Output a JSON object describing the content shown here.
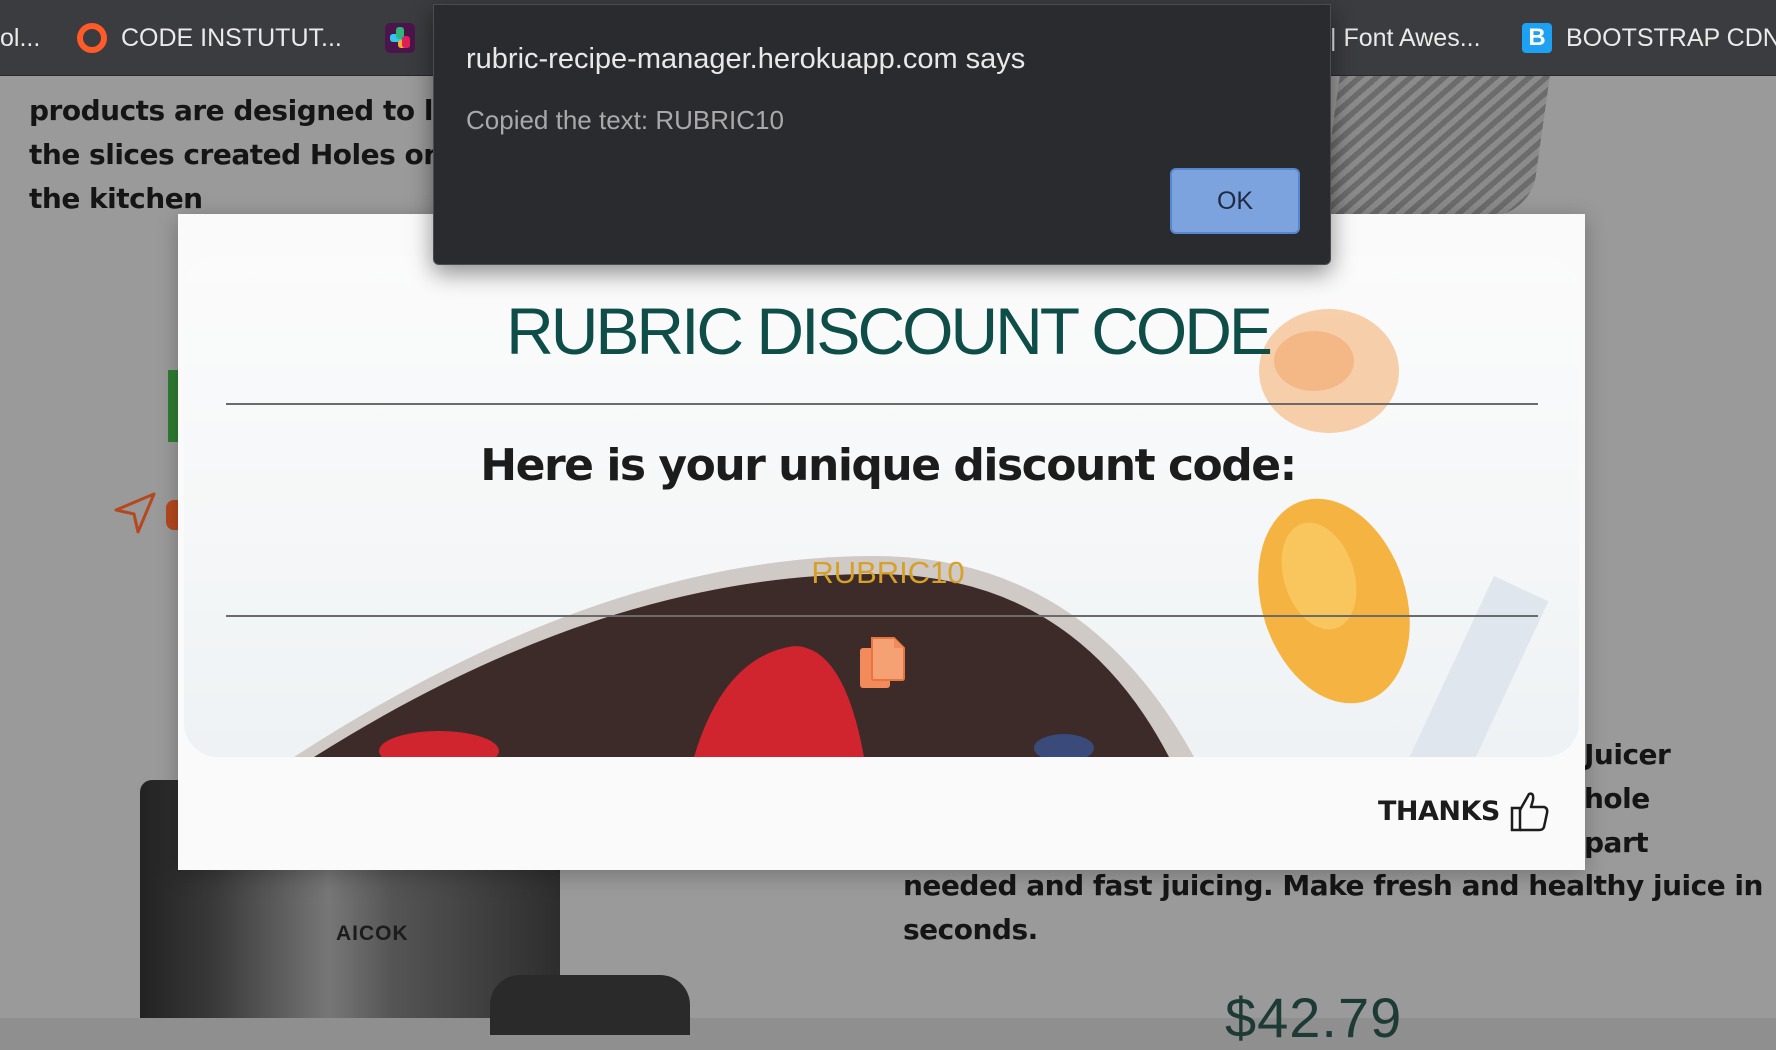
{
  "bookmarks": [
    {
      "label": "ol...",
      "icon": "none"
    },
    {
      "label": "CODE INSTUTUT...",
      "icon": "code-institute-ring-icon"
    },
    {
      "label": "",
      "icon": "slack-icon"
    },
    {
      "label": "| Font Awes...",
      "icon": "none"
    },
    {
      "label": "BOOTSTRAP CDN",
      "icon": "bootstrap-icon"
    }
  ],
  "background_page": {
    "left_paragraph": [
      "products are designed to las",
      "the slices created Holes on t",
      "the kitchen"
    ],
    "right_fragments": [
      "Juicer",
      "hole",
      "part"
    ],
    "right_paragraph": [
      "needed and fast juicing. Make fresh and healthy juice in",
      "seconds."
    ],
    "price": "$42.79",
    "product_brand": "AICOK"
  },
  "modal": {
    "title": "RUBRIC DISCOUNT CODE",
    "subtitle": "Here is your unique discount code:",
    "code": "RUBRIC10",
    "copy_icon": "copy-icon",
    "thanks_label": "THANKS",
    "thanks_icon": "thumbs-up-icon"
  },
  "alert": {
    "title": "rubric-recipe-manager.herokuapp.com says",
    "message": "Copied the text: RUBRIC10",
    "ok_label": "OK"
  },
  "colors": {
    "title_teal": "#0e4d48",
    "code_gold": "#d7a02b",
    "copy_orange": "#f28a5b",
    "alert_bg": "#2a2b2e",
    "ok_blue": "#7da3df"
  }
}
